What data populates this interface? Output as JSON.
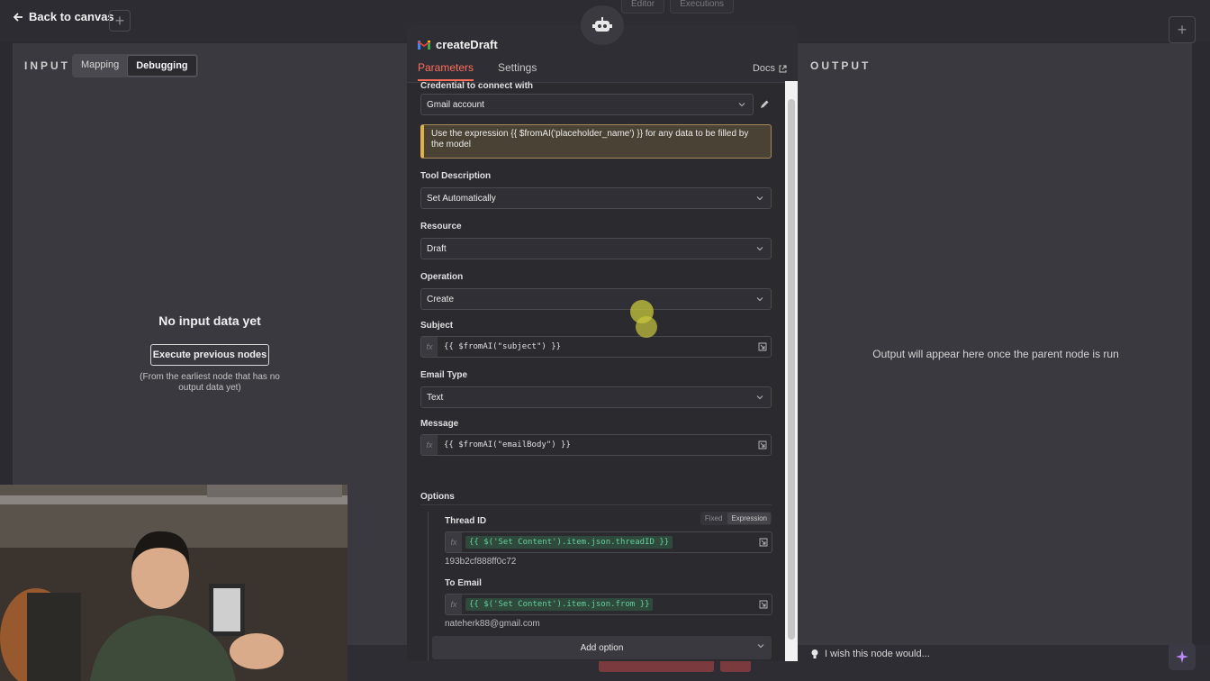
{
  "topbar": {
    "back_label": "Back to canvas",
    "tab_editor": "Editor",
    "tab_executions": "Executions"
  },
  "input_panel": {
    "title": "INPUT",
    "mapping_label": "Mapping",
    "debugging_label": "Debugging",
    "empty_title": "No input data yet",
    "execute_button": "Execute previous nodes",
    "empty_note": "(From the earliest node that has no output data yet)"
  },
  "output_panel": {
    "title": "OUTPUT",
    "message": "Output will appear here once the parent node is run"
  },
  "node": {
    "title": "createDraft",
    "tabs": {
      "parameters": "Parameters",
      "settings": "Settings",
      "docs": "Docs"
    },
    "credential": {
      "label": "Credential to connect with",
      "value": "Gmail account"
    },
    "notice": "Use the expression {{ $fromAI('placeholder_name') }} for any data to be filled by the model",
    "tool_description": {
      "label": "Tool Description",
      "value": "Set Automatically"
    },
    "resource": {
      "label": "Resource",
      "value": "Draft"
    },
    "operation": {
      "label": "Operation",
      "value": "Create"
    },
    "subject": {
      "label": "Subject",
      "value": "{{ $fromAI(\"subject\") }}"
    },
    "email_type": {
      "label": "Email Type",
      "value": "Text"
    },
    "message": {
      "label": "Message",
      "value": "{{ $fromAI(\"emailBody\") }}"
    },
    "options": {
      "label": "Options",
      "thread_id": {
        "label": "Thread ID",
        "value": "{{ $('Set Content').item.json.threadID }}",
        "result": "193b2cf888ff0c72",
        "fixed": "Fixed",
        "expression": "Expression"
      },
      "to_email": {
        "label": "To Email",
        "value": "{{ $('Set Content').item.json.from }}",
        "result": "nateherk88@gmail.com"
      },
      "add_option": "Add option"
    },
    "fx_label": "fx"
  },
  "footer": {
    "wish_text": "I wish this node would..."
  },
  "colors": {
    "accent": "#ff6d5a",
    "expression_green": "#63d09a",
    "notice_border": "#e0b04a"
  },
  "icons": [
    "arrow-left-icon",
    "plus-icon",
    "robot-icon",
    "gmail-icon",
    "external-link-icon",
    "chevron-down-icon",
    "pencil-icon",
    "expand-icon",
    "lightbulb-icon",
    "sparkle-icon"
  ]
}
